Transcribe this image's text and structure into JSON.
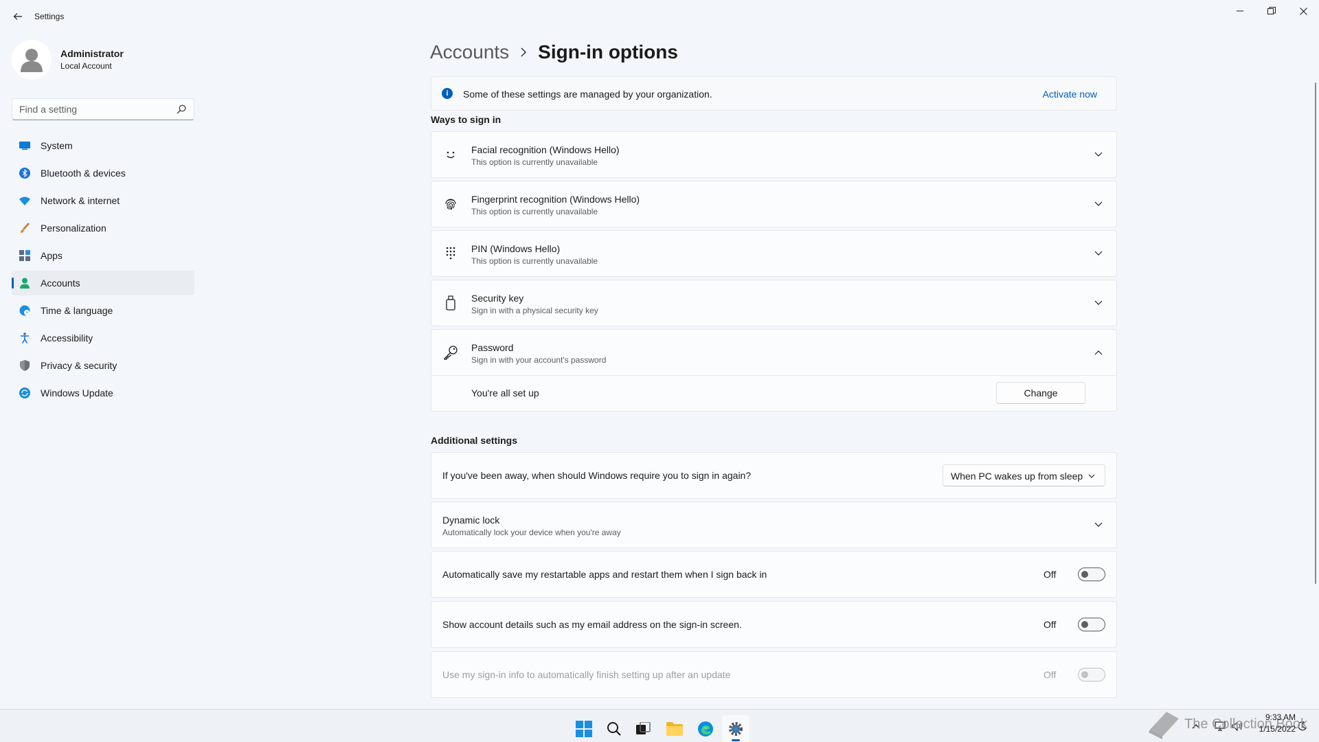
{
  "window": {
    "title": "Settings"
  },
  "profile": {
    "name": "Administrator",
    "account_type": "Local Account"
  },
  "search": {
    "placeholder": "Find a setting"
  },
  "nav": {
    "items": [
      {
        "label": "System",
        "icon": "monitor-icon"
      },
      {
        "label": "Bluetooth & devices",
        "icon": "bluetooth-icon"
      },
      {
        "label": "Network & internet",
        "icon": "wifi-icon"
      },
      {
        "label": "Personalization",
        "icon": "brush-icon"
      },
      {
        "label": "Apps",
        "icon": "apps-icon"
      },
      {
        "label": "Accounts",
        "icon": "person-icon",
        "active": true
      },
      {
        "label": "Time & language",
        "icon": "globe-clock-icon"
      },
      {
        "label": "Accessibility",
        "icon": "accessibility-icon"
      },
      {
        "label": "Privacy & security",
        "icon": "shield-icon"
      },
      {
        "label": "Windows Update",
        "icon": "sync-icon"
      }
    ]
  },
  "breadcrumb": {
    "parent": "Accounts",
    "current": "Sign-in options"
  },
  "info_bar": {
    "text": "Some of these settings are managed by your organization.",
    "link": "Activate now"
  },
  "ways_to_sign_in": {
    "title": "Ways to sign in",
    "items": [
      {
        "title": "Facial recognition (Windows Hello)",
        "subtitle": "This option is currently unavailable",
        "icon": "face-icon"
      },
      {
        "title": "Fingerprint recognition (Windows Hello)",
        "subtitle": "This option is currently unavailable",
        "icon": "fingerprint-icon"
      },
      {
        "title": "PIN (Windows Hello)",
        "subtitle": "This option is currently unavailable",
        "icon": "keypad-icon"
      },
      {
        "title": "Security key",
        "subtitle": "Sign in with a physical security key",
        "icon": "usb-key-icon"
      },
      {
        "title": "Password",
        "subtitle": "Sign in with your account's password",
        "icon": "key-icon",
        "expanded": true
      }
    ],
    "password_status": "You're all set up",
    "password_button": "Change"
  },
  "additional_settings": {
    "title": "Additional settings",
    "require_signin_question": "If you've been away, when should Windows require you to sign in again?",
    "require_signin_value": "When PC wakes up from sleep",
    "dynamic_lock_title": "Dynamic lock",
    "dynamic_lock_subtitle": "Automatically lock your device when you're away",
    "toggles": [
      {
        "label": "Automatically save my restartable apps and restart them when I sign back in",
        "state": "Off",
        "on": false,
        "disabled": false
      },
      {
        "label": "Show account details such as my email address on the sign-in screen.",
        "state": "Off",
        "on": false,
        "disabled": false
      },
      {
        "label": "Use my sign-in info to automatically finish setting up after an update",
        "state": "Off",
        "on": false,
        "disabled": true
      }
    ]
  },
  "taskbar": {
    "time": "9:33 AM",
    "date": "1/15/2022",
    "watermark": "The Collection Book"
  },
  "colors": {
    "accent": "#005fb8",
    "background": "#f3f6fa",
    "card": "#fbfcfd"
  }
}
